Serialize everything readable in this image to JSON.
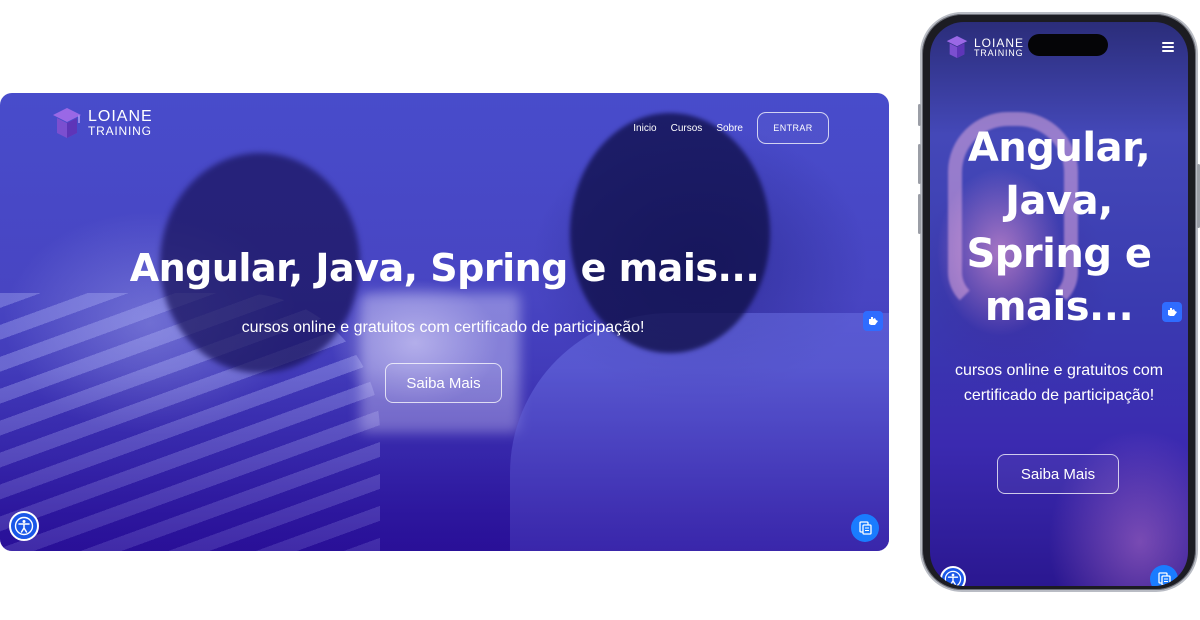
{
  "brand": {
    "line1": "LOIANE",
    "line2": "TRAINING"
  },
  "nav": {
    "items": [
      {
        "label": "Inicio"
      },
      {
        "label": "Cursos"
      },
      {
        "label": "Sobre"
      }
    ],
    "login_label": "ENTRAR"
  },
  "hero": {
    "title": "Angular, Java, Spring e mais...",
    "subtitle": "cursos online e gratuitos com certificado de participação!",
    "cta_label": "Saiba Mais"
  },
  "icons": {
    "logo": "graduation-cap-icon",
    "accessibility": "accessibility-icon",
    "sign_language": "hand-libras-icon",
    "chat": "chat-widget-icon",
    "menu": "hamburger-menu-icon"
  },
  "colors": {
    "hero_overlay": "#4a47c4",
    "accent_blue": "#1a57e8",
    "logo_purple": "#7b4fd0"
  }
}
